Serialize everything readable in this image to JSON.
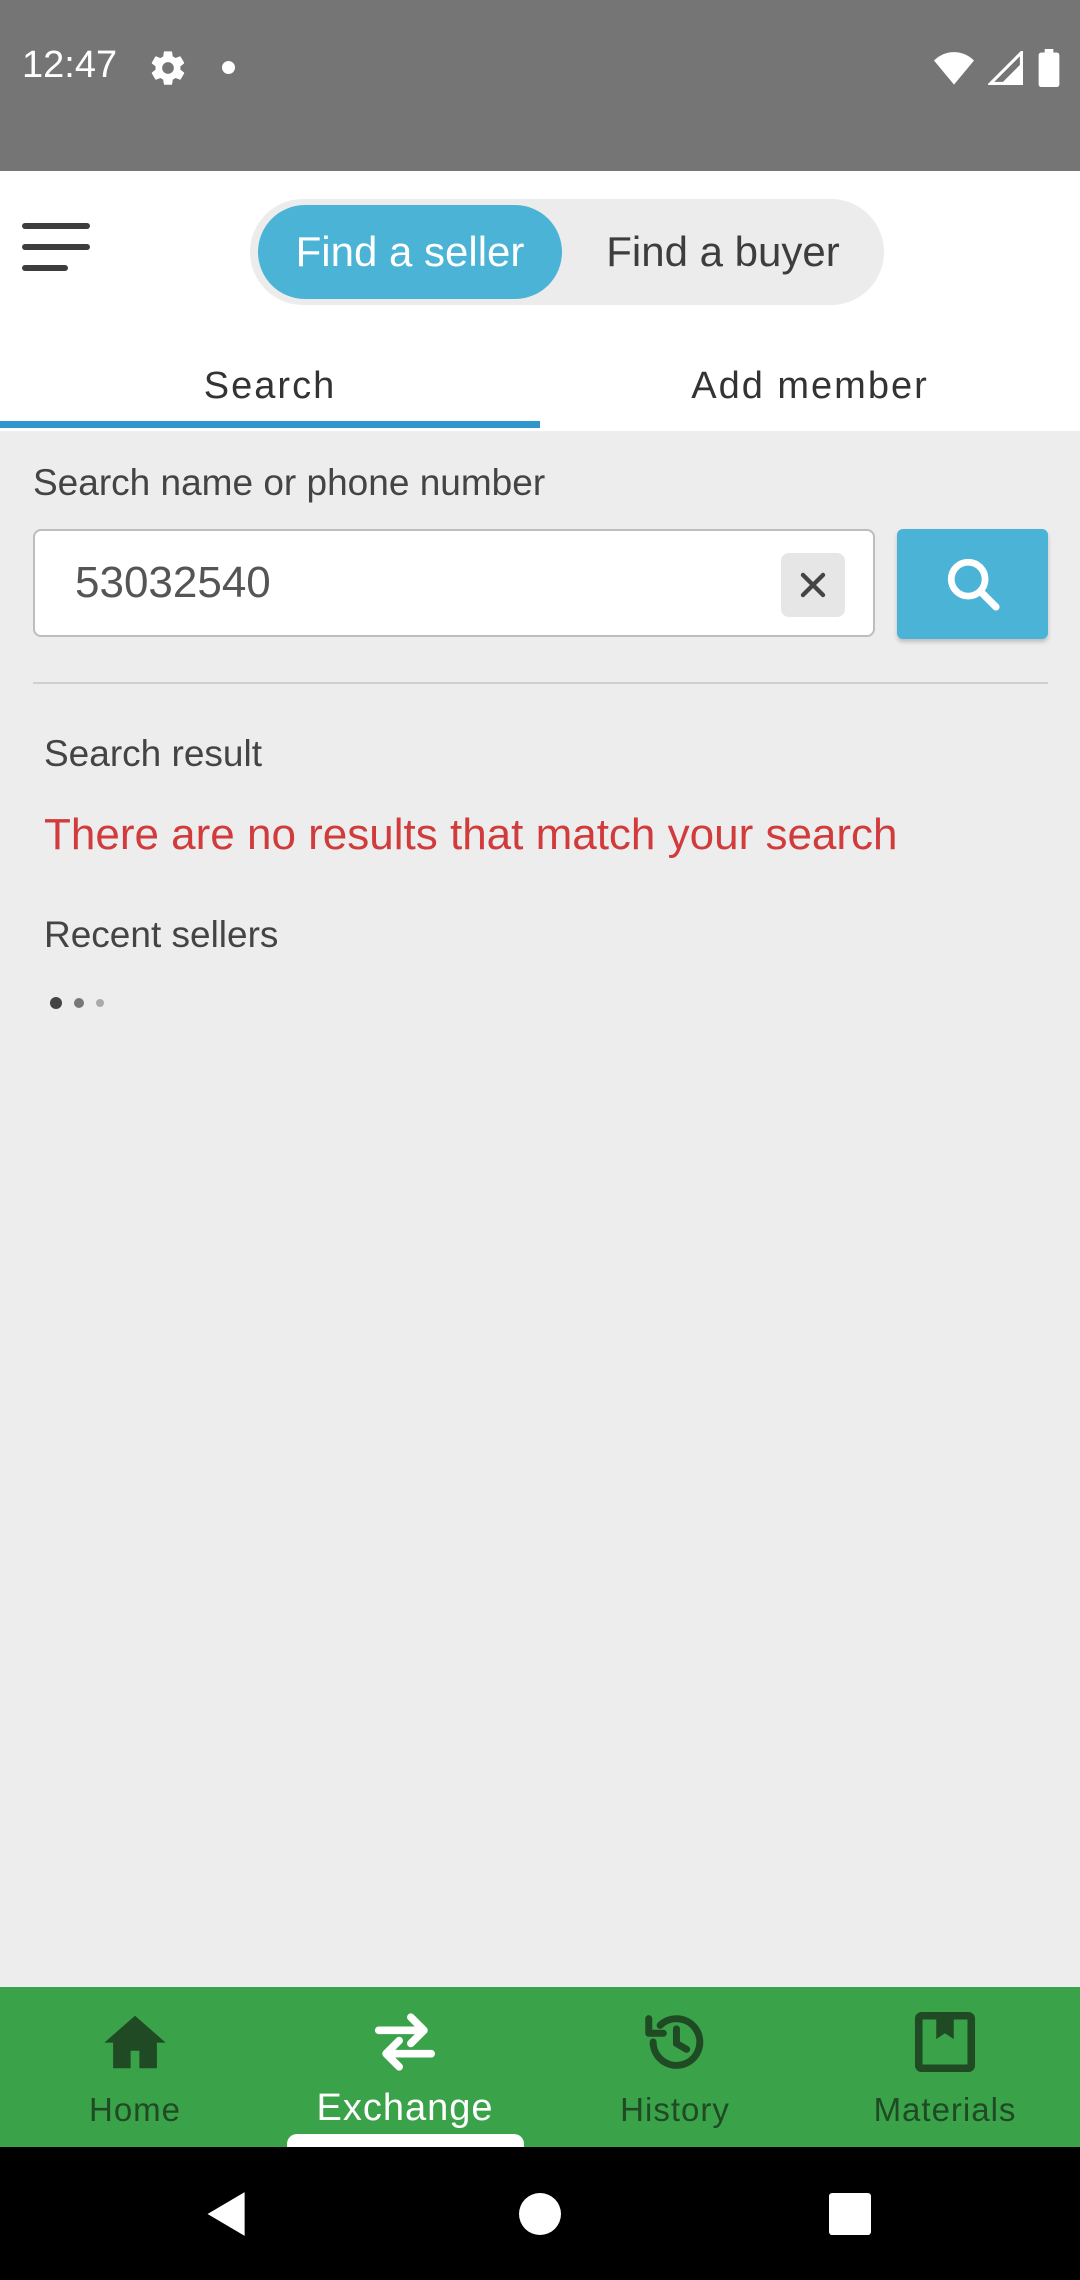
{
  "status_bar": {
    "time": "12:47",
    "icons": [
      "gear-icon",
      "notification-dot-icon",
      "wifi-icon",
      "signal-icon",
      "battery-icon"
    ]
  },
  "header": {
    "menu_icon": "hamburger-menu-icon",
    "toggle": {
      "options": [
        "Find a seller",
        "Find a buyer"
      ],
      "selected": "Find a seller"
    },
    "tabs": [
      {
        "label": "Search",
        "active": true
      },
      {
        "label": "Add member",
        "active": false
      }
    ]
  },
  "search": {
    "label": "Search name or phone number",
    "value": "53032540",
    "placeholder": "",
    "clear_icon": "close-icon",
    "submit_icon": "search-icon"
  },
  "results": {
    "heading": "Search result",
    "empty_message": "There are no results that match your search",
    "recent_heading": "Recent sellers"
  },
  "bottom_nav": {
    "items": [
      {
        "label": "Home",
        "icon": "home-icon",
        "active": false
      },
      {
        "label": "Exchange",
        "icon": "exchange-icon",
        "active": true
      },
      {
        "label": "History",
        "icon": "history-icon",
        "active": false
      },
      {
        "label": "Materials",
        "icon": "materials-icon",
        "active": false
      }
    ]
  },
  "colors": {
    "status_bar": "#757575",
    "accent": "#4ab3d6",
    "tab_indicator": "#2f97cc",
    "error": "#d13b3b",
    "bottom_nav": "#3aa34a",
    "nav_inactive": "#1f4a24"
  }
}
